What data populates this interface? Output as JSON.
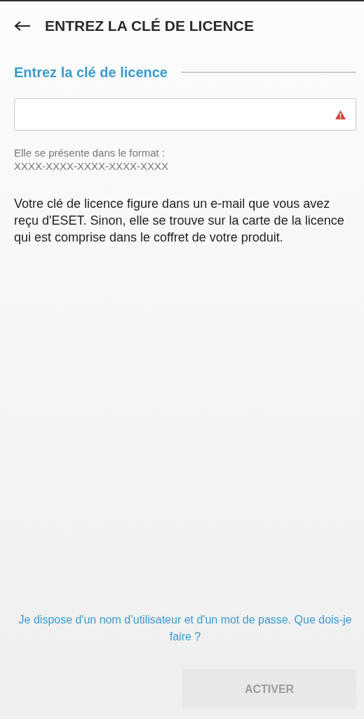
{
  "header": {
    "title": "ENTREZ LA CLÉ DE LICENCE"
  },
  "section": {
    "title": "Entrez la clé de licence"
  },
  "license_field": {
    "error": true
  },
  "format_hint": {
    "lines": [
      "Elle se présente dans le format :",
      "XXXX-XXXX-XXXX-XXXX-XXXX"
    ]
  },
  "description": "Votre clé de licence figure dans un e-mail que vous avez reçu d'ESET. Sinon, elle se trouve sur la carte de la licence qui est comprise dans le coffret de votre produit.",
  "credentials_link": "Je dispose d'un nom d’utilisateur et d'un mot de passe. Que dois-je faire ?",
  "activate_button": {
    "label": "ACTIVER",
    "disabled": true
  }
}
